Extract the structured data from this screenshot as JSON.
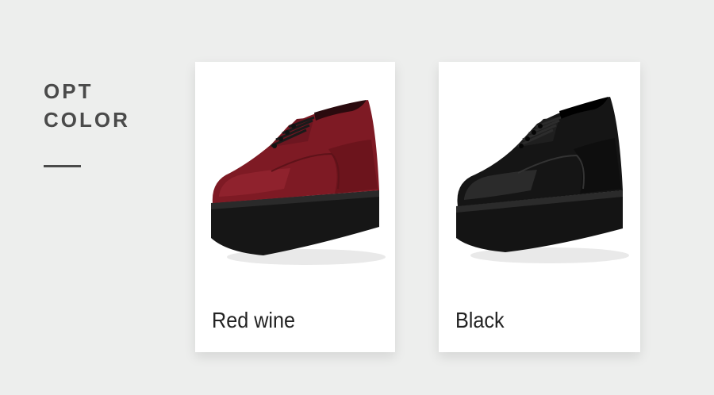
{
  "section": {
    "heading_line1": "OPT",
    "heading_line2": "COLOR"
  },
  "options": [
    {
      "label": "Red wine",
      "color": "#7e1a24",
      "icon": "red-wine-shoe"
    },
    {
      "label": "Black",
      "color": "#151515",
      "icon": "black-shoe"
    }
  ]
}
